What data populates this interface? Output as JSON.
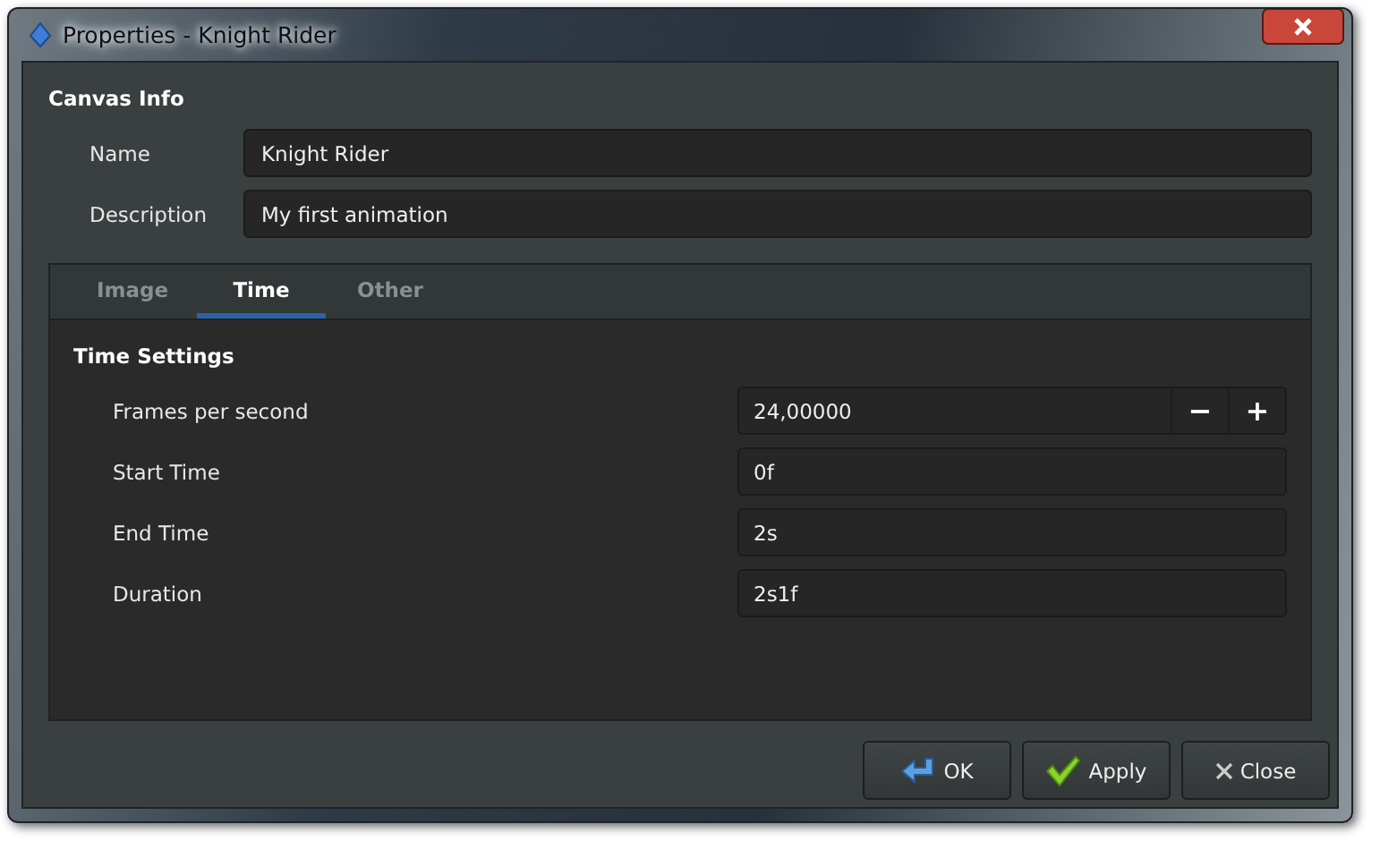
{
  "window": {
    "title": "Properties - Knight Rider"
  },
  "canvas_info": {
    "title": "Canvas Info",
    "fields": [
      {
        "label": "Name",
        "value": "Knight Rider"
      },
      {
        "label": "Description",
        "value": "My first animation"
      }
    ]
  },
  "tabs": [
    {
      "label": "Image",
      "selected": false
    },
    {
      "label": "Time",
      "selected": true
    },
    {
      "label": "Other",
      "selected": false
    }
  ],
  "time_settings": {
    "title": "Time Settings",
    "rows": [
      {
        "kind": "spin",
        "label": "Frames per second",
        "value": "24,00000",
        "decrement": "−",
        "increment": "+"
      },
      {
        "kind": "text",
        "label": "Start Time",
        "value": "0f"
      },
      {
        "kind": "text",
        "label": "End Time",
        "value": "2s"
      },
      {
        "kind": "text",
        "label": "Duration",
        "value": "2s1f"
      }
    ]
  },
  "buttons": [
    {
      "kind": "ok",
      "label": "OK"
    },
    {
      "kind": "apply",
      "label": "Apply"
    },
    {
      "kind": "close",
      "label": "Close"
    }
  ]
}
